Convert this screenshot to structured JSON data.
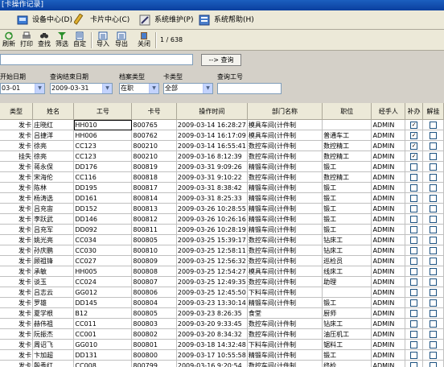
{
  "window": {
    "title": "[卡操作记录]"
  },
  "menu": [
    {
      "label": "设备中心(D)",
      "icon": "device-icon"
    },
    {
      "label": "卡片中心(C)",
      "icon": "card-icon"
    },
    {
      "label": "系统维护(P)",
      "icon": "maintenance-icon"
    },
    {
      "label": "系统帮助(H)",
      "icon": "help-icon"
    }
  ],
  "toolbar": {
    "buttons": [
      {
        "label": "刷新",
        "icon": "refresh-icon"
      },
      {
        "label": "打印",
        "icon": "print-icon"
      },
      {
        "label": "查找",
        "icon": "find-icon"
      },
      {
        "label": "筛选",
        "icon": "filter-icon"
      },
      {
        "label": "自定",
        "icon": "customize-icon"
      },
      {
        "label": "导入",
        "icon": "import-icon"
      },
      {
        "label": "导出",
        "icon": "export-icon"
      },
      {
        "label": "关闭",
        "icon": "close-icon"
      }
    ],
    "pager": "1 / 638"
  },
  "search": {
    "value": "",
    "button": "--> 查询"
  },
  "filters": {
    "start_label": "开始日期",
    "start_value": "03-01",
    "end_label": "查询结束日期",
    "end_value": "2009-03-31",
    "archive_label": "档案类型",
    "archive_value": "在职",
    "card_type_label": "卡类型",
    "card_type_value": "全部",
    "emp_label": "查询工号",
    "emp_value": ""
  },
  "grid": {
    "columns": [
      "类型",
      "姓名",
      "工号",
      "卡号",
      "操作时间",
      "部门名称",
      "职位",
      "经手人",
      "补办",
      "解挂"
    ],
    "rows": [
      [
        "发卡",
        "庄晓红",
        "HH010",
        "800765",
        "2009-03-14 16:28:27",
        "模具车间(计件制",
        "",
        "ADMIN",
        true,
        false
      ],
      [
        "发卡",
        "吕捷洋",
        "HH006",
        "800762",
        "2009-03-14 16:17:09",
        "模具车间(计件制",
        "普通车工",
        "ADMIN",
        true,
        false
      ],
      [
        "发卡",
        "徐亮",
        "CC123",
        "800210",
        "2009-03-14 16:55:41",
        "数控车间(计件制",
        "数控精工",
        "ADMIN",
        true,
        false
      ],
      [
        "挂失",
        "徐亮",
        "CC123",
        "800210",
        "2009-03-16 8:12:39",
        "数控车间(计件制",
        "数控精工",
        "ADMIN",
        true,
        false
      ],
      [
        "发卡",
        "蒋永保",
        "DD176",
        "800819",
        "2009-03-31 9:09:26",
        "精锻车间(计件制",
        "锻工",
        "ADMIN",
        false,
        false
      ],
      [
        "发卡",
        "宋海伦",
        "CC116",
        "800818",
        "2009-03-31 9:10:22",
        "数控车间(计件制",
        "数控精工",
        "ADMIN",
        false,
        false
      ],
      [
        "发卡",
        "陈林",
        "DD195",
        "800817",
        "2009-03-31 8:38:42",
        "精锻车间(计件制",
        "锻工",
        "ADMIN",
        false,
        false
      ],
      [
        "发卡",
        "杨涛选",
        "DD161",
        "800814",
        "2009-03-31 8:25:33",
        "精锻车间(计件制",
        "锻工",
        "ADMIN",
        false,
        false
      ],
      [
        "发卡",
        "吕充宙",
        "DD152",
        "800813",
        "2009-03-26 10:28:55",
        "精锻车间(计件制",
        "锻工",
        "ADMIN",
        false,
        false
      ],
      [
        "发卡",
        "李跃武",
        "DD146",
        "800812",
        "2009-03-26 10:26:16",
        "精锻车间(计件制",
        "锻工",
        "ADMIN",
        false,
        false
      ],
      [
        "发卡",
        "吕充军",
        "DD092",
        "800811",
        "2009-03-26 10:28:19",
        "精锻车间(计件制",
        "锻工",
        "ADMIN",
        false,
        false
      ],
      [
        "发卡",
        "姚光亮",
        "CC034",
        "800805",
        "2009-03-25 15:39:17",
        "数控车间(计件制",
        "钻床工",
        "ADMIN",
        false,
        false
      ],
      [
        "发卡",
        "孙庆鹏",
        "CC030",
        "800810",
        "2009-03-25 12:58:11",
        "数控车间(计件制",
        "钻床工",
        "ADMIN",
        false,
        false
      ],
      [
        "发卡",
        "顾祖锋",
        "CC027",
        "800809",
        "2009-03-25 12:56:32",
        "数控车间(计件制",
        "巡检员",
        "ADMIN",
        false,
        false
      ],
      [
        "发卡",
        "承敏",
        "HH005",
        "800808",
        "2009-03-25 12:54:27",
        "模具车间(计件制",
        "线床工",
        "ADMIN",
        false,
        false
      ],
      [
        "发卡",
        "谈玉",
        "CC024",
        "800807",
        "2009-03-25 12:49:35",
        "数控车间(计件制",
        "助理",
        "ADMIN",
        false,
        false
      ],
      [
        "发卡",
        "吕志云",
        "GG012",
        "800806",
        "2009-03-25 12:45:50",
        "下料车间(计件制",
        "",
        "ADMIN",
        false,
        false
      ],
      [
        "发卡",
        "罗雄",
        "DD145",
        "800804",
        "2009-03-23 13:30:14",
        "精锻车间(计件制",
        "锻工",
        "ADMIN",
        false,
        false
      ],
      [
        "发卡",
        "夏学根",
        "B12",
        "800805",
        "2009-03-23 8:26:35",
        "食堂",
        "厨师",
        "ADMIN",
        false,
        false
      ],
      [
        "发卡",
        "赫伟祖",
        "CC011",
        "800803",
        "2009-03-20 9:33:45",
        "数控车间(计件制",
        "钻床工",
        "ADMIN",
        false,
        false
      ],
      [
        "发卡",
        "阮振杰",
        "CC001",
        "800802",
        "2009-03-20 8:34:32",
        "数控车间(计件制",
        "油压机工",
        "ADMIN",
        false,
        false
      ],
      [
        "发卡",
        "周诏飞",
        "GG010",
        "800801",
        "2009-03-18 14:32:48",
        "下料车间(计件制",
        "锯料工",
        "ADMIN",
        false,
        false
      ],
      [
        "发卡",
        "卞加超",
        "DD131",
        "800800",
        "2009-03-17 10:55:58",
        "精锻车间(计件制",
        "锻工",
        "ADMIN",
        false,
        false
      ],
      [
        "发卡",
        "殷秀红",
        "CC008",
        "800799",
        "2009-03-16 9:20:54",
        "数控车间(计件制",
        "终检",
        "ADMIN",
        false,
        false
      ]
    ]
  }
}
